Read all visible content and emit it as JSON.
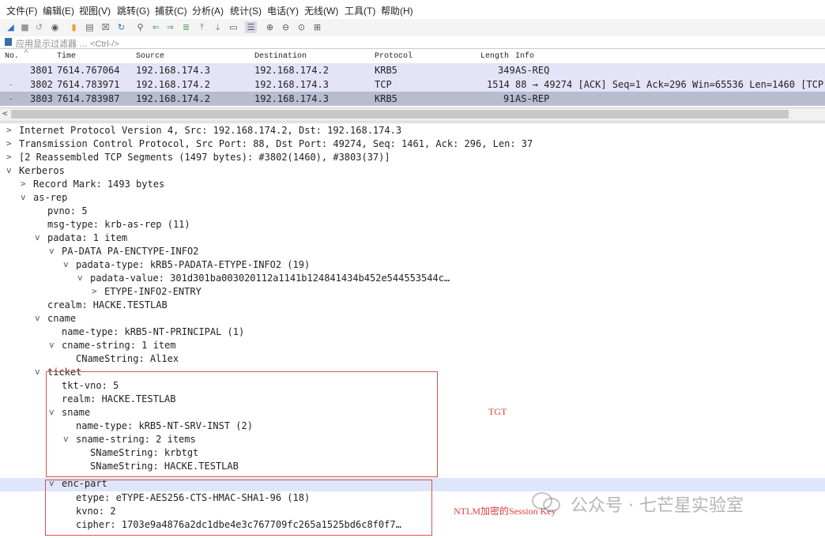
{
  "menu": [
    "文件(F)",
    "编辑(E)",
    "视图(V)",
    "跳转(G)",
    "捕获(C)",
    "分析(A)",
    "统计(S)",
    "电话(Y)",
    "无线(W)",
    "工具(T)",
    "帮助(H)"
  ],
  "filter": {
    "placeholder": "应用显示过滤器 … <Ctrl-/>"
  },
  "columns": {
    "no": "No.",
    "time": "Time",
    "source": "Source",
    "destination": "Destination",
    "protocol": "Protocol",
    "length": "Length",
    "info": "Info"
  },
  "packets": [
    {
      "no": "3801",
      "time": "7614.767064",
      "src": "192.168.174.3",
      "dst": "192.168.174.2",
      "proto": "KRB5",
      "len": "349",
      "info": "AS-REQ"
    },
    {
      "no": "3802",
      "time": "7614.783971",
      "src": "192.168.174.2",
      "dst": "192.168.174.3",
      "proto": "TCP",
      "len": "1514",
      "info": "88 → 49274 [ACK] Seq=1 Ack=296 Win=65536 Len=1460 [TCP"
    },
    {
      "no": "3803",
      "time": "7614.783987",
      "src": "192.168.174.2",
      "dst": "192.168.174.3",
      "proto": "KRB5",
      "len": "91",
      "info": "AS-REP"
    }
  ],
  "tree": [
    {
      "arrow": ">",
      "text": "Internet Protocol Version 4, Src: 192.168.174.2, Dst: 192.168.174.3"
    },
    {
      "arrow": ">",
      "text": "Transmission Control Protocol, Src Port: 88, Dst Port: 49274, Seq: 1461, Ack: 296, Len: 37"
    },
    {
      "arrow": ">",
      "text": "[2 Reassembled TCP Segments (1497 bytes): #3802(1460), #3803(37)]"
    },
    {
      "arrow": "v",
      "text": "Kerberos"
    },
    {
      "arrow": ">",
      "text": "Record Mark: 1493 bytes"
    },
    {
      "arrow": "v",
      "text": "as-rep"
    },
    {
      "arrow": "",
      "text": "pvno: 5"
    },
    {
      "arrow": "",
      "text": "msg-type: krb-as-rep (11)"
    },
    {
      "arrow": "v",
      "text": "padata: 1 item"
    },
    {
      "arrow": "v",
      "text": "PA-DATA PA-ENCTYPE-INFO2"
    },
    {
      "arrow": "v",
      "text": "padata-type: kRB5-PADATA-ETYPE-INFO2 (19)"
    },
    {
      "arrow": "v",
      "text": "padata-value: 301d301ba003020112a1141b124841434b452e544553544c…"
    },
    {
      "arrow": ">",
      "text": "ETYPE-INFO2-ENTRY"
    },
    {
      "arrow": "",
      "text": "crealm: HACKE.TESTLAB"
    },
    {
      "arrow": "v",
      "text": "cname"
    },
    {
      "arrow": "",
      "text": "name-type: kRB5-NT-PRINCIPAL (1)"
    },
    {
      "arrow": "v",
      "text": "cname-string: 1 item"
    },
    {
      "arrow": "",
      "text": "CNameString: Al1ex"
    },
    {
      "arrow": "v",
      "text": "ticket"
    },
    {
      "arrow": "",
      "text": "tkt-vno: 5"
    },
    {
      "arrow": "",
      "text": "realm: HACKE.TESTLAB"
    },
    {
      "arrow": "v",
      "text": "sname"
    },
    {
      "arrow": "",
      "text": "name-type: kRB5-NT-SRV-INST (2)"
    },
    {
      "arrow": "v",
      "text": "sname-string: 2 items"
    },
    {
      "arrow": "",
      "text": "SNameString: krbtgt"
    },
    {
      "arrow": "",
      "text": "SNameString: HACKE.TESTLAB"
    },
    {
      "arrow": "v",
      "text": "enc-part"
    },
    {
      "arrow": "",
      "text": "etype: eTYPE-AES256-CTS-HMAC-SHA1-96 (18)"
    },
    {
      "arrow": "",
      "text": "kvno: 2"
    },
    {
      "arrow": "",
      "text": "cipher: 1703e9a4876a2dc1dbe4e3c767709fc265a1525bd6c8f0f7…"
    }
  ],
  "annotations": {
    "tgt": "TGT",
    "session_key": "NTLM加密的Session Key"
  },
  "watermark": "公众号 · 七芒星实验室",
  "colors": {
    "accent_red": "#d9534f",
    "selected_row": "#b8bccf",
    "krb_row": "#e4e4f8",
    "highlight_row": "#dde6fb"
  }
}
